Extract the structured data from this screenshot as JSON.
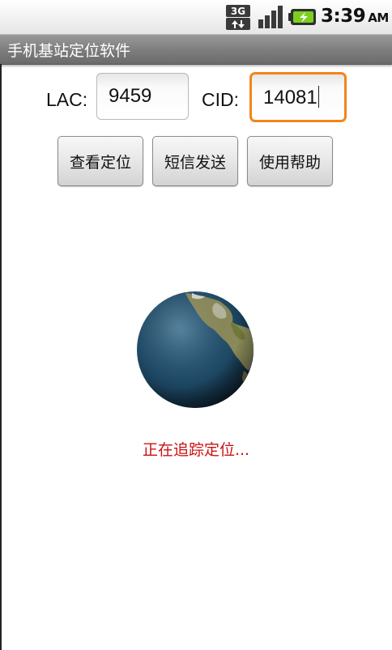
{
  "status_bar": {
    "network_type": "3G",
    "network_icon": "network-3g-icon",
    "signal_icon": "signal-strength-icon",
    "battery_icon": "battery-charging-icon",
    "time": "3:39",
    "ampm": "AM"
  },
  "app": {
    "title": "手机基站定位软件"
  },
  "form": {
    "lac_label": "LAC:",
    "lac_value": "9459",
    "cid_label": "CID:",
    "cid_value": "14081"
  },
  "buttons": {
    "locate": "查看定位",
    "sms": "短信发送",
    "help": "使用帮助"
  },
  "main": {
    "globe_icon": "earth-globe-icon",
    "status_message": "正在追踪定位..."
  },
  "colors": {
    "focus_border": "#f2851a",
    "status_text": "#cc1111",
    "title_bar": "#7c7c7c"
  }
}
